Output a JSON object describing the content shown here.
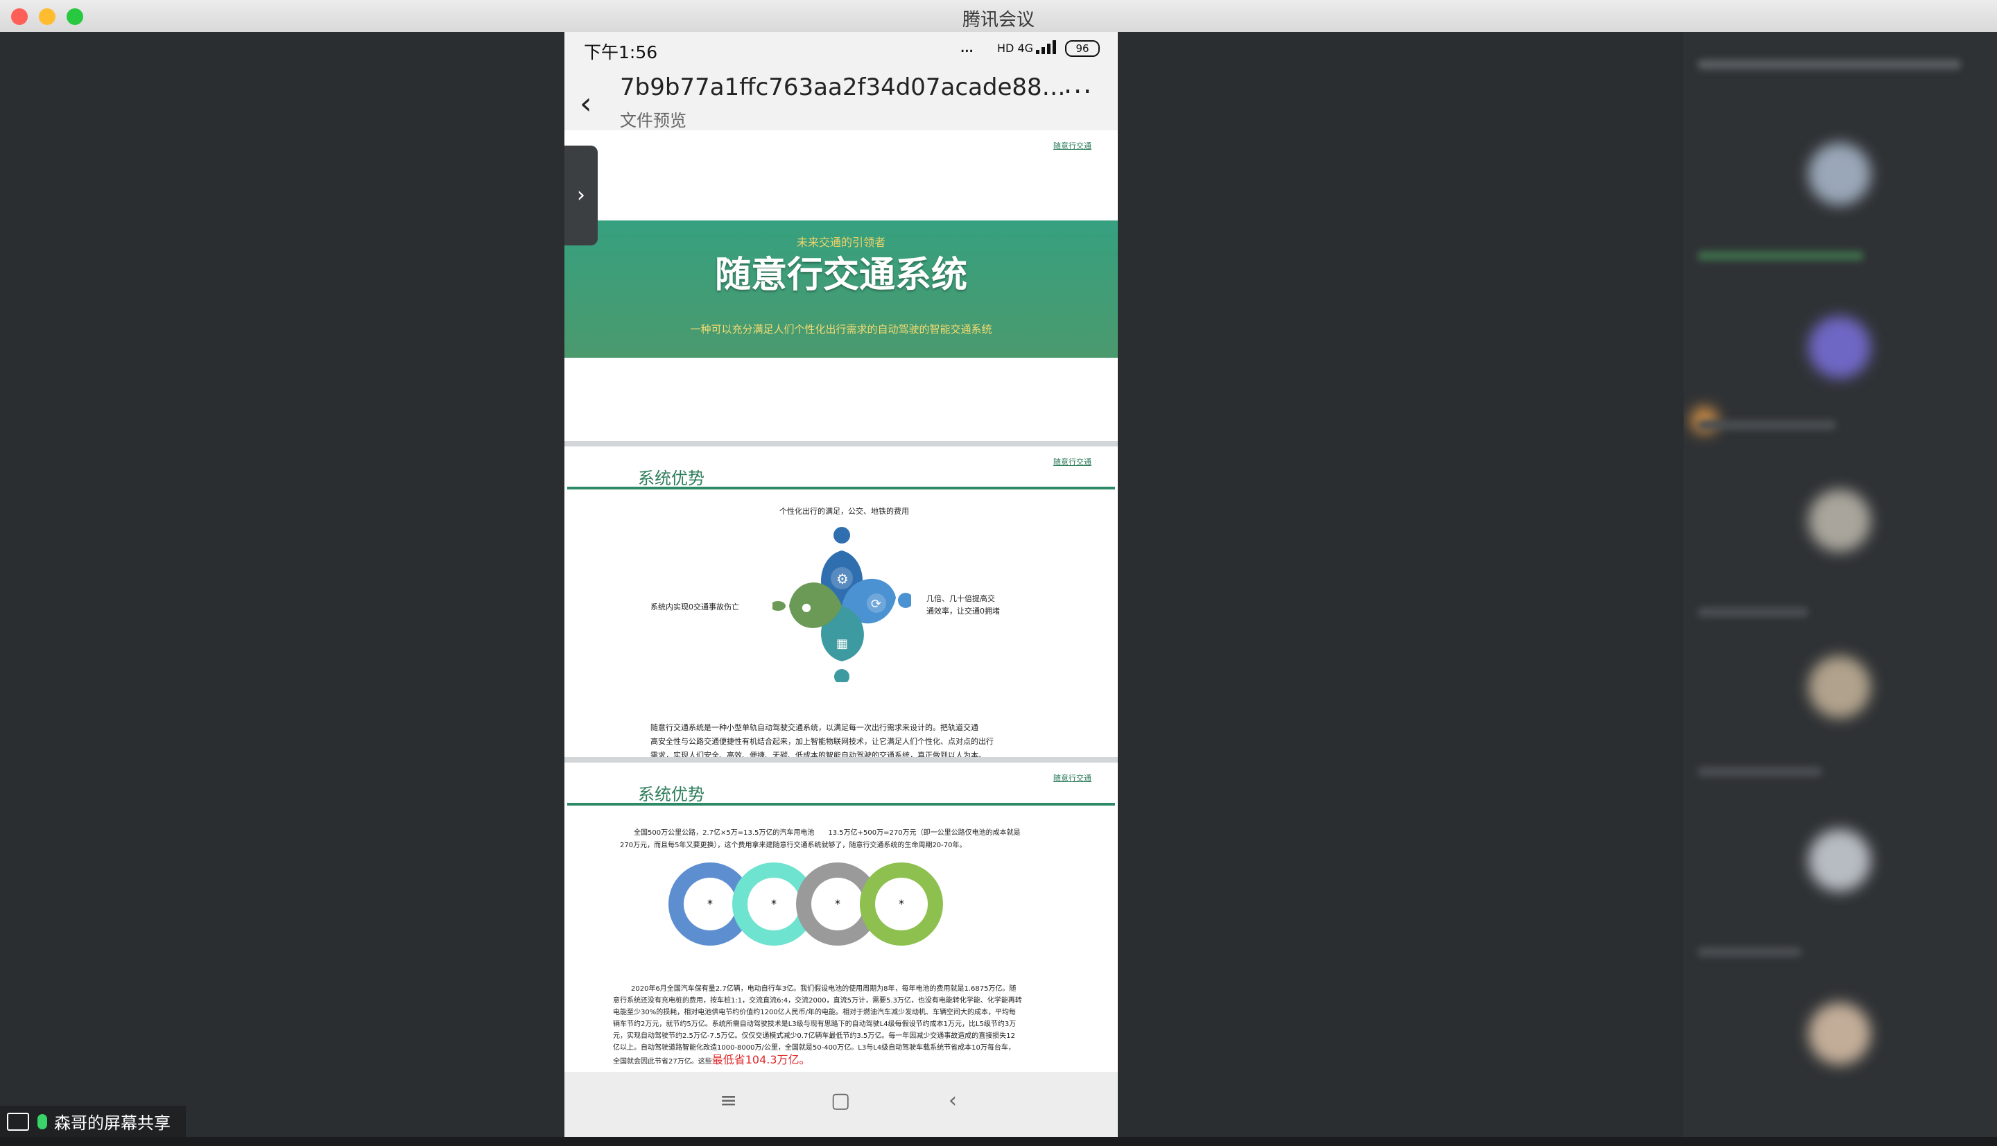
{
  "window": {
    "title": "腾讯会议"
  },
  "share": {
    "label": "森哥的屏幕共享"
  },
  "status_bar": {
    "time": "下午1:56",
    "dots": "...",
    "network": "HD 4G",
    "battery": "96"
  },
  "nav": {
    "back": "‹",
    "filename": "7b9b77a1ffc763aa2f34d07acade88…",
    "subtitle": "文件预览",
    "more": "···"
  },
  "drawer": {
    "icon": "›"
  },
  "slide1": {
    "tag": "随意行交通",
    "pretitle": "未来交通的引领者",
    "title": "随意行交通系统",
    "subtitle": "一种可以充分满足人们个性化出行需求的自动驾驶的智能交通系统"
  },
  "slide2": {
    "tag": "随意行交通",
    "heading": "系统优势",
    "top_label": "个性化出行的满足，公交、地铁的费用",
    "left_label": "系统内实现0交通事故伤亡",
    "right_label_1": "几倍、几十倍提高交",
    "right_label_2": "通效率，让交通0拥堵",
    "para_1": "随意行交通系统是一种小型单轨自动驾驶交通系统，以满足每一次出行需求来设计的。把轨道交通",
    "para_2": "高安全性与公路交通便捷性有机结合起来，加上智能物联网技术，让它满足人们个性化、点对点的出行",
    "para_3": "需求，实现人们安全、高效、便捷、无碳、低成本的智能自动驾驶的交通系统，真正做到以人为本。",
    "colors": {
      "dark_blue": "#2f6fb0",
      "blue": "#4b92d3",
      "teal": "#3c9aa0",
      "green": "#6a9a56"
    }
  },
  "slide3": {
    "tag": "随意行交通",
    "heading": "系统优势",
    "intro_1": "全国500万公里公路，2.7亿×5万=13.5万亿的汽车用电池　　13.5万亿+500万=270万元（即一公里公路仅电池的成本就是",
    "intro_2": "270万元，而且每5年又要更换），这个费用拿来建随意行交通系统就够了，随意行交通系统的生命周期20-70年。",
    "rings": [
      "*",
      "*",
      "*",
      "*"
    ],
    "ring_colors": [
      "#5d8fd0",
      "#6ee3cf",
      "#9a9a9a",
      "#8dc04f"
    ],
    "body_1": "2020年6月全国汽车保有量2.7亿辆，电动自行车3亿。我们假设电池的使用周期为8年，每年电池的费用就是1.6875万亿。随",
    "body_2": "意行系统还没有充电桩的费用，按车桩1:1，交流直流6:4，交流2000，直流5万计，需要5.3万亿，也没有电能转化学能、化学能再转",
    "body_3": "电能至少30%的损耗，相对电池供电节约价值约1200亿人民币/年的电能。相对于燃油汽车减少发动机、车辆空间大的成本，平均每",
    "body_4": "辆车节约2万元，就节约5万亿。系统所需自动驾驶技术是L3级与现有思路下的自动驾驶L4级每假设节约成本1万元，比L5级节约3万",
    "body_5": "元，实现自动驾驶节约2.5万亿-7.5万亿。仅仅交通模式减少0.7亿辆车最低节约3.5万亿。每一年因减少交通事故造成的直接损失12",
    "body_6": "亿以上。自动驾驶道路智能化改造1000-8000万/公里，全国就是50-400万亿。L3与L4级自动驾驶车载系统节省成本10万每台车，",
    "body_7": "全国就会因此节省27万亿。这些",
    "highlight": "最低省104.3万亿。"
  },
  "home_bar": {
    "menu": "≡",
    "home": "▢",
    "back": "‹"
  }
}
